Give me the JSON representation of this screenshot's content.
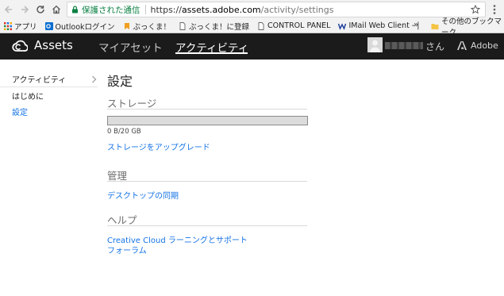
{
  "browser": {
    "secure_label": "保護された通信",
    "url_scheme": "https://",
    "url_host": "assets.adobe.com",
    "url_path": "/activity/settings",
    "bookmarks": [
      {
        "label": "アプリ",
        "icon": "apps-grid-icon"
      },
      {
        "label": "Outlookログイン",
        "icon": "outlook-icon"
      },
      {
        "label": "ぶっくま！",
        "icon": "bookmark-icon"
      },
      {
        "label": "ぶっくま！に登録",
        "icon": "page-icon"
      },
      {
        "label": "CONTROL PANEL",
        "icon": "page-icon"
      },
      {
        "label": "IMail Web Client - |",
        "icon": "imail-icon"
      }
    ],
    "more_bookmarks": "»",
    "other_bookmarks": "その他のブックマーク"
  },
  "header": {
    "brand": "Assets",
    "nav": [
      {
        "label": "マイアセット",
        "active": false
      },
      {
        "label": "アクティビティ",
        "active": true
      }
    ],
    "user_suffix": "さん",
    "adobe_label": "Adobe"
  },
  "sidebar": {
    "items": [
      {
        "label": "アクティビティ"
      },
      {
        "label": "はじめに"
      },
      {
        "label": "設定"
      }
    ]
  },
  "main": {
    "title": "設定",
    "storage": {
      "heading": "ストレージ",
      "used_fraction": 0,
      "usage_text": "0 B/20 GB",
      "upgrade_link": "ストレージをアップグレード"
    },
    "manage": {
      "heading": "管理",
      "sync_link": "デスクトップの同期"
    },
    "help": {
      "heading": "ヘルプ",
      "learning_link": "Creative Cloud ラーニングとサポート",
      "forum_link": "フォーラム"
    }
  },
  "colors": {
    "accent": "#1473e6",
    "header_bg": "#1b1b1b",
    "secure": "#0b8043"
  }
}
